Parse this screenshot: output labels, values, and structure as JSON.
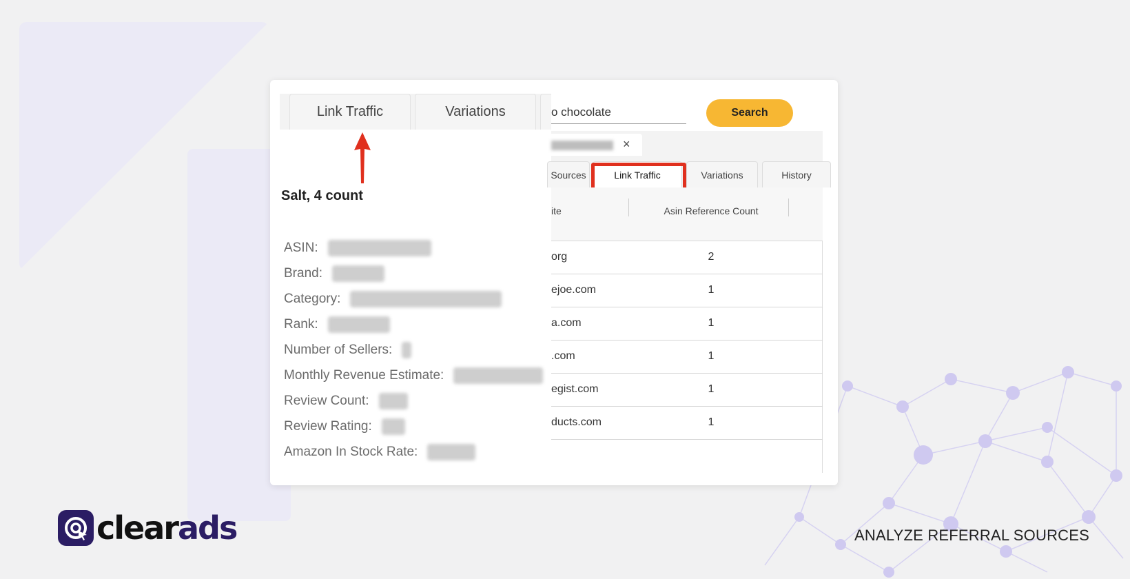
{
  "left_panel": {
    "tabs": [
      "Link Traffic",
      "Variations"
    ],
    "product_title": "Salt, 4 count",
    "fields": [
      {
        "label": "ASIN:"
      },
      {
        "label": "Brand:"
      },
      {
        "label": "Category:"
      },
      {
        "label": "Rank:"
      },
      {
        "label": "Number of Sellers:"
      },
      {
        "label": "Monthly Revenue Estimate:"
      },
      {
        "label": "Review Count:"
      },
      {
        "label": "Review Rating:"
      },
      {
        "label": "Amazon In Stock Rate:"
      }
    ]
  },
  "right_panel": {
    "search_value": "o chocolate",
    "search_button": "Search",
    "chip_close": "×",
    "tabs": [
      "Sources",
      "Link Traffic",
      "Variations",
      "History"
    ],
    "active_tab": "Link Traffic",
    "highlight_color": "#e0301e",
    "table": {
      "columns": [
        "ite",
        "Asin Reference Count"
      ],
      "rows": [
        {
          "site": "org",
          "count": "2"
        },
        {
          "site": "ejoe.com",
          "count": "1"
        },
        {
          "site": "a.com",
          "count": "1"
        },
        {
          "site": ".com",
          "count": "1"
        },
        {
          "site": "egist.com",
          "count": "1"
        },
        {
          "site": "ducts.com",
          "count": "1"
        }
      ]
    }
  },
  "brand": {
    "logo_prefix": "clear",
    "logo_suffix": "ads",
    "tagline": "ANALYZE REFERRAL SOURCES",
    "brand_color": "#2b1d64",
    "search_color": "#f7b733"
  }
}
